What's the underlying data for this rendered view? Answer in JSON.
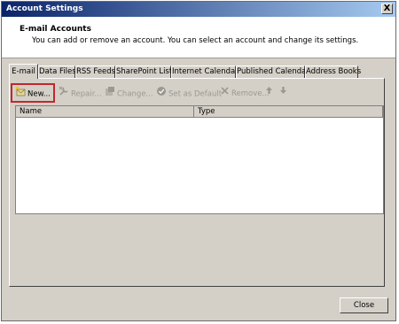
{
  "window": {
    "title": "Account Settings",
    "close_glyph": "X"
  },
  "header": {
    "title": "E-mail Accounts",
    "description": "You can add or remove an account. You can select an account and change its settings."
  },
  "tabs": [
    {
      "label": "E-mail",
      "active": true
    },
    {
      "label": "Data Files",
      "active": false
    },
    {
      "label": "RSS Feeds",
      "active": false
    },
    {
      "label": "SharePoint Lists",
      "active": false
    },
    {
      "label": "Internet Calendars",
      "active": false
    },
    {
      "label": "Published Calendars",
      "active": false
    },
    {
      "label": "Address Books",
      "active": false
    }
  ],
  "toolbar": {
    "new_label": "New...",
    "repair_label": "Repair...",
    "change_label": "Change...",
    "set_default_label": "Set as Default",
    "remove_label": "Remove...",
    "highlight_color": "#c0282d"
  },
  "list": {
    "columns": [
      "Name",
      "Type"
    ],
    "rows": []
  },
  "footer": {
    "close_label": "Close"
  },
  "colors": {
    "title_start": "#0a246a",
    "title_end": "#a6caf0",
    "dialog_bg": "#d4d0c8"
  }
}
